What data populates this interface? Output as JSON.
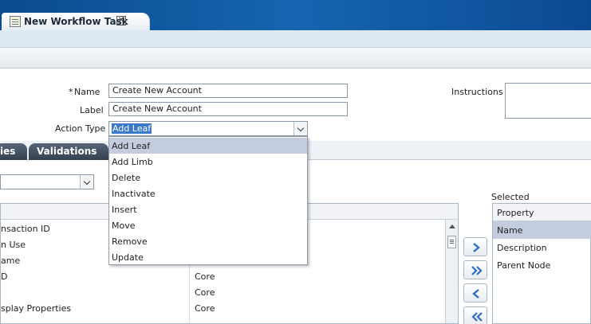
{
  "tab": {
    "title": "New Workflow Task",
    "close": "✕"
  },
  "form": {
    "name_label": "Name",
    "name_required": "*",
    "name_value": "Create New Account",
    "label_label": "Label",
    "label_value": "Create New Account",
    "action_type_label": "Action Type",
    "action_type_value": "Add Leaf",
    "instructions_label": "Instructions"
  },
  "subtabs": [
    "ies",
    "Validations"
  ],
  "dropdown": {
    "options": [
      "Add Leaf",
      "Add Limb",
      "Delete",
      "Inactivate",
      "Insert",
      "Move",
      "Remove",
      "Update"
    ],
    "selected_index": 0
  },
  "grid": {
    "rows": [
      {
        "name": "nsaction ID",
        "type": ""
      },
      {
        "name": "n Use",
        "type": ""
      },
      {
        "name": "ame",
        "type": ""
      },
      {
        "name": "D",
        "type": "Core"
      },
      {
        "name": "",
        "type": "Core"
      },
      {
        "name": "splay Properties",
        "type": "Core"
      }
    ]
  },
  "selected": {
    "label": "Selected",
    "header": "Property",
    "items": [
      "Name",
      "Description",
      "Parent Node"
    ],
    "active_index": 0
  }
}
